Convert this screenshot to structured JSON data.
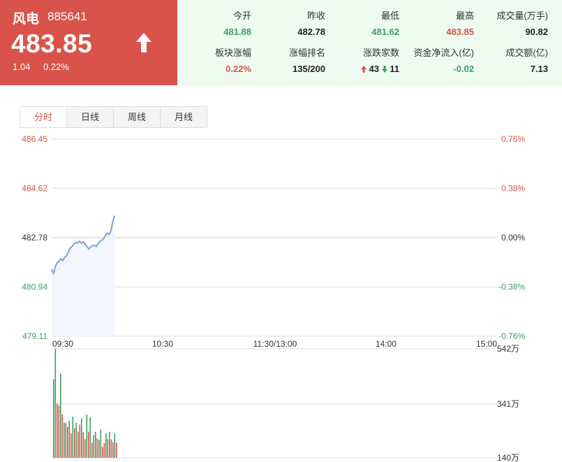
{
  "quote": {
    "name": "风电",
    "code": "885641",
    "price": "483.85",
    "change": "1.04",
    "change_pct": "0.22%",
    "direction": "up"
  },
  "stats": [
    {
      "label": "今开",
      "value": "481.88",
      "color": "green"
    },
    {
      "label": "昨收",
      "value": "482.78",
      "color": "dark"
    },
    {
      "label": "最低",
      "value": "481.62",
      "color": "green"
    },
    {
      "label": "最高",
      "value": "483.85",
      "color": "red"
    },
    {
      "label": "成交量(万手)",
      "value": "90.82",
      "color": "dark"
    },
    {
      "label": "板块涨幅",
      "value": "0.22%",
      "color": "red"
    },
    {
      "label": "涨幅排名",
      "value": "135/200",
      "color": "dark"
    },
    {
      "label": "涨跌家数",
      "up_count": "43",
      "down_count": "11"
    },
    {
      "label": "资金净流入(亿)",
      "value": "-0.02",
      "color": "green"
    },
    {
      "label": "成交额(亿)",
      "value": "7.13",
      "color": "dark"
    }
  ],
  "tabs": [
    {
      "label": "分时",
      "active": true
    },
    {
      "label": "日线",
      "active": false
    },
    {
      "label": "周线",
      "active": false
    },
    {
      "label": "月线",
      "active": false
    }
  ],
  "colors": {
    "up": "#d9534a",
    "down": "#3f9e62",
    "line": "#7aa3d4",
    "area": "#f4f6fd",
    "grid": "#dddddd"
  },
  "chart_data": [
    {
      "type": "line",
      "y_ticks_left": [
        "486.45",
        "484.62",
        "482.78",
        "480.94",
        "479.11"
      ],
      "y_ticks_right": [
        "0.76%",
        "0.38%",
        "0.00%",
        "-0.38%",
        "-0.76%"
      ],
      "x_ticks": [
        "09:30",
        "10:30",
        "11:30/13:00",
        "14:00",
        "15:00"
      ],
      "ylim": [
        479.11,
        486.45
      ],
      "baseline": 482.78,
      "total_minutes": 240,
      "series": [
        {
          "values": [
            481.6,
            481.45,
            481.7,
            481.85,
            481.9,
            482.0,
            481.92,
            482.05,
            482.1,
            482.25,
            482.4,
            482.45,
            482.55,
            482.6,
            482.58,
            482.65,
            482.58,
            482.62,
            482.55,
            482.45,
            482.36,
            482.42,
            482.48,
            482.5,
            482.45,
            482.55,
            482.65,
            482.68,
            482.75,
            482.85,
            482.95,
            482.9,
            483.05,
            483.4,
            483.6
          ]
        }
      ]
    },
    {
      "type": "bar",
      "y_ticks": [
        "542万",
        "341万",
        "140万"
      ],
      "ylim": [
        140,
        542
      ],
      "values": [
        430,
        542,
        340,
        333,
        450,
        300,
        270,
        268,
        254,
        276,
        230,
        292,
        250,
        270,
        236,
        262,
        286,
        234,
        209,
        300,
        236,
        290,
        196,
        224,
        236,
        212,
        206,
        245,
        180,
        194,
        230,
        209,
        236,
        208,
        198,
        229,
        196
      ],
      "up_flags": [
        0,
        0,
        1,
        1,
        0,
        1,
        0,
        1,
        1,
        0,
        1,
        0,
        1,
        0,
        1,
        1,
        0,
        1,
        1,
        0,
        1,
        0,
        1,
        0,
        1,
        0,
        1,
        0,
        1,
        1,
        0,
        1,
        0,
        1,
        1,
        0,
        1
      ]
    }
  ]
}
